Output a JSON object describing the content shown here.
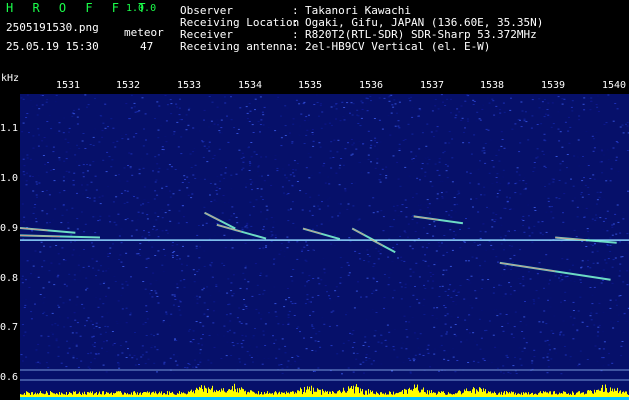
{
  "header": {
    "logo": "H R O F F T",
    "version": "1.0.0",
    "filename": "2505191530.png",
    "meteor_label": "meteor",
    "datetime": "25.05.19 15:30",
    "meteor_count": "47"
  },
  "meta": [
    {
      "label": "Observer",
      "value": "Takanori Kawachi"
    },
    {
      "label": "Receiving Location",
      "value": "Ogaki, Gifu, JAPAN (136.60E, 35.35N)"
    },
    {
      "label": "Receiver",
      "value": "R820T2(RTL-SDR) SDR-Sharp 53.372MHz"
    },
    {
      "label": "Receiving antenna",
      "value": "2el-HB9CV Vertical (el. E-W)"
    }
  ],
  "meta_separator": ":",
  "colors": {
    "text": "#ffffff",
    "logo": "#1aff4a",
    "background": "#000000",
    "noise_base": "#06106a",
    "trace": "#7fffd4",
    "power_bar": "#ffff00",
    "power_base": "#00bfff"
  },
  "chart_data": {
    "type": "heatmap",
    "yunit": "kHz",
    "x_ticks": [
      "1531",
      "1532",
      "1533",
      "1534",
      "1535",
      "1536",
      "1537",
      "1538",
      "1539",
      "1540"
    ],
    "y_ticks": [
      "1.1",
      "1.0",
      "0.9",
      "0.8",
      "0.7",
      "0.6"
    ],
    "xlim": [
      1530.2,
      1540.1
    ],
    "ylim": [
      0.58,
      1.16
    ],
    "carrier_khz": 0.883,
    "traces": [
      {
        "x": [
          1530.2,
          1531.1
        ],
        "y": [
          0.906,
          0.897
        ]
      },
      {
        "x": [
          1530.2,
          1531.5
        ],
        "y": [
          0.892,
          0.888
        ]
      },
      {
        "x": [
          1533.2,
          1533.7
        ],
        "y": [
          0.935,
          0.905
        ]
      },
      {
        "x": [
          1533.4,
          1534.2
        ],
        "y": [
          0.912,
          0.886
        ]
      },
      {
        "x": [
          1534.8,
          1535.4
        ],
        "y": [
          0.905,
          0.885
        ]
      },
      {
        "x": [
          1535.6,
          1536.0
        ],
        "y": [
          0.905,
          0.88
        ]
      },
      {
        "x": [
          1535.9,
          1536.3
        ],
        "y": [
          0.885,
          0.86
        ]
      },
      {
        "x": [
          1536.6,
          1537.4
        ],
        "y": [
          0.928,
          0.915
        ]
      },
      {
        "x": [
          1538.9,
          1539.9
        ],
        "y": [
          0.888,
          0.878
        ]
      },
      {
        "x": [
          1538.0,
          1539.8
        ],
        "y": [
          0.84,
          0.808
        ]
      }
    ],
    "grid": false
  }
}
